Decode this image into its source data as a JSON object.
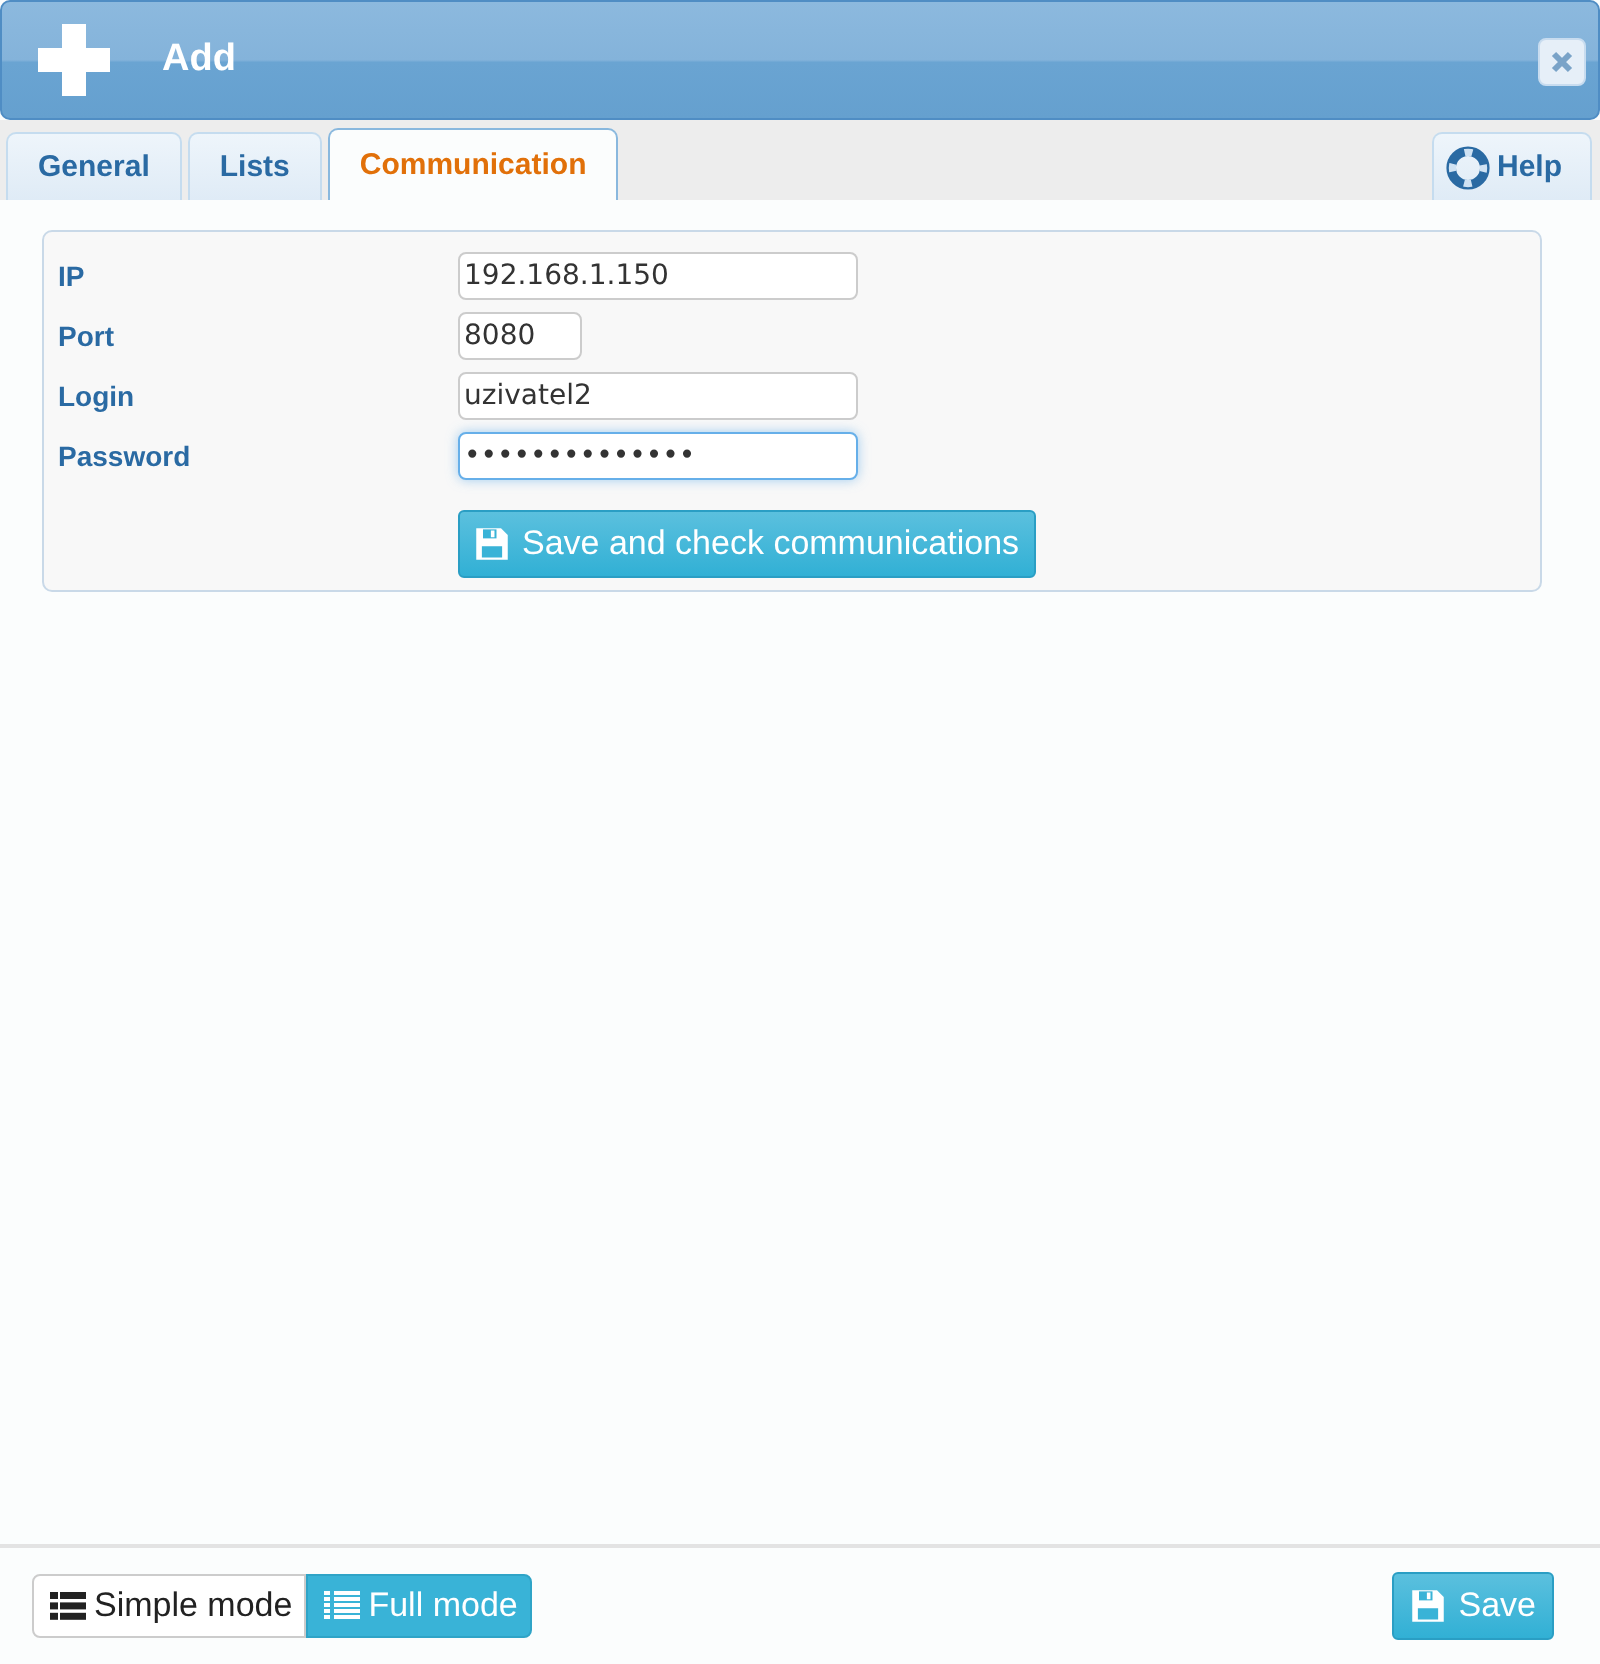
{
  "window": {
    "title": "Add"
  },
  "tabs": [
    {
      "label": "General",
      "selected": false
    },
    {
      "label": "Lists",
      "selected": false
    },
    {
      "label": "Communication",
      "selected": true
    }
  ],
  "help": {
    "label": "Help"
  },
  "form": {
    "fields": [
      {
        "label": "IP",
        "value": "192.168.1.150",
        "kind": "text",
        "focused": false
      },
      {
        "label": "Port",
        "value": "8080",
        "kind": "number",
        "focused": false
      },
      {
        "label": "Login",
        "value": "uzivatel2",
        "kind": "text",
        "focused": false
      },
      {
        "label": "Password",
        "value": "••••••••••••••",
        "kind": "password",
        "focused": true
      }
    ],
    "action": "Save and check communications"
  },
  "modes": [
    {
      "label": "Simple mode",
      "selected": false
    },
    {
      "label": "Full mode",
      "selected": true
    }
  ],
  "save": "Save"
}
